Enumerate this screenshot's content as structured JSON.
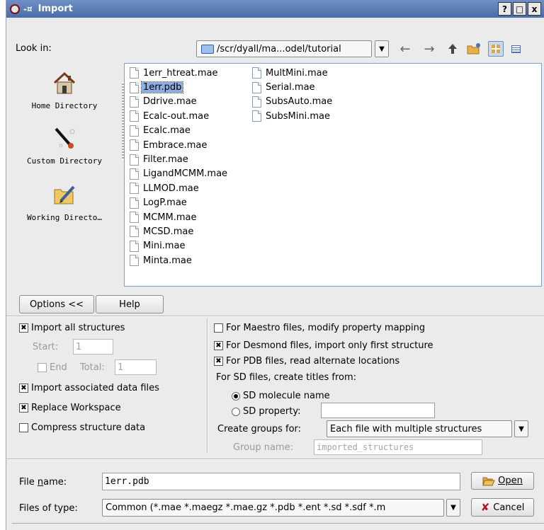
{
  "window": {
    "title": "Import",
    "pin_glyph": "-¤",
    "help_btn": "?",
    "max_btn": "□",
    "close_btn": "x"
  },
  "toolbar": {
    "look_in_label": "Look in:",
    "path": "/scr/dyall/ma...odel/tutorial",
    "back_icon": "←",
    "forward_icon": "→",
    "up_icon": "🡅"
  },
  "sidebar": {
    "items": [
      {
        "label": "Home Directory",
        "icon": "house-icon"
      },
      {
        "label": "Custom Directory",
        "icon": "wand-icon"
      },
      {
        "label": "Working Directo…",
        "icon": "folder-pen-icon"
      }
    ]
  },
  "files": {
    "col1": [
      "1err_htreat.mae",
      "1err.pdb",
      "Ddrive.mae",
      "Ecalc-out.mae",
      "Ecalc.mae",
      "Embrace.mae",
      "Filter.mae",
      "LigandMCMM.mae",
      "LLMOD.mae",
      "LogP.mae",
      "MCMM.mae",
      "MCSD.mae",
      "Mini.mae",
      "Minta.mae"
    ],
    "col2": [
      "MultMini.mae",
      "Serial.mae",
      "SubsAuto.mae",
      "SubsMini.mae"
    ],
    "selected": "1err.pdb"
  },
  "buttons": {
    "options": "Options <<",
    "help": "Help",
    "open": "Open",
    "cancel": "Cancel"
  },
  "left_options": {
    "import_all": {
      "label": "Import all structures",
      "checked": true
    },
    "start_label": "Start:",
    "start_value": "1",
    "end_label": "End",
    "total_label": "Total:",
    "total_value": "1",
    "import_assoc": {
      "label": "Import associated data files",
      "checked": true
    },
    "replace_ws": {
      "label": "Replace Workspace",
      "checked": true
    },
    "compress": {
      "label": "Compress structure data",
      "checked": false
    }
  },
  "right_options": {
    "maestro": {
      "label": "For Maestro files, modify property mapping",
      "checked": false
    },
    "desmond": {
      "label": "For Desmond files, import only first structure",
      "checked": true
    },
    "pdb": {
      "label": "For PDB files, read alternate locations",
      "checked": true
    },
    "sd_titles_label": "For SD files, create titles from:",
    "sd_molecule": "SD molecule name",
    "sd_property": "SD property:",
    "sd_property_value": "",
    "groups_label": "Create groups for:",
    "groups_value": "Each file with multiple structures",
    "group_name_label": "Group name:",
    "group_name_value": "imported_structures"
  },
  "footer": {
    "filename_label_pre": "File ",
    "filename_label_ul": "n",
    "filename_label_post": "ame:",
    "filename_value": "1err.pdb",
    "filetype_label": "Files of type:",
    "filetype_value": "Common (*.mae *.maegz *.mae.gz *.pdb *.ent *.sd *.sdf *.m"
  },
  "colors": {
    "titlebar": "#4a6ea9",
    "selection": "#8eaee3",
    "list_border": "#7f9ccc"
  }
}
